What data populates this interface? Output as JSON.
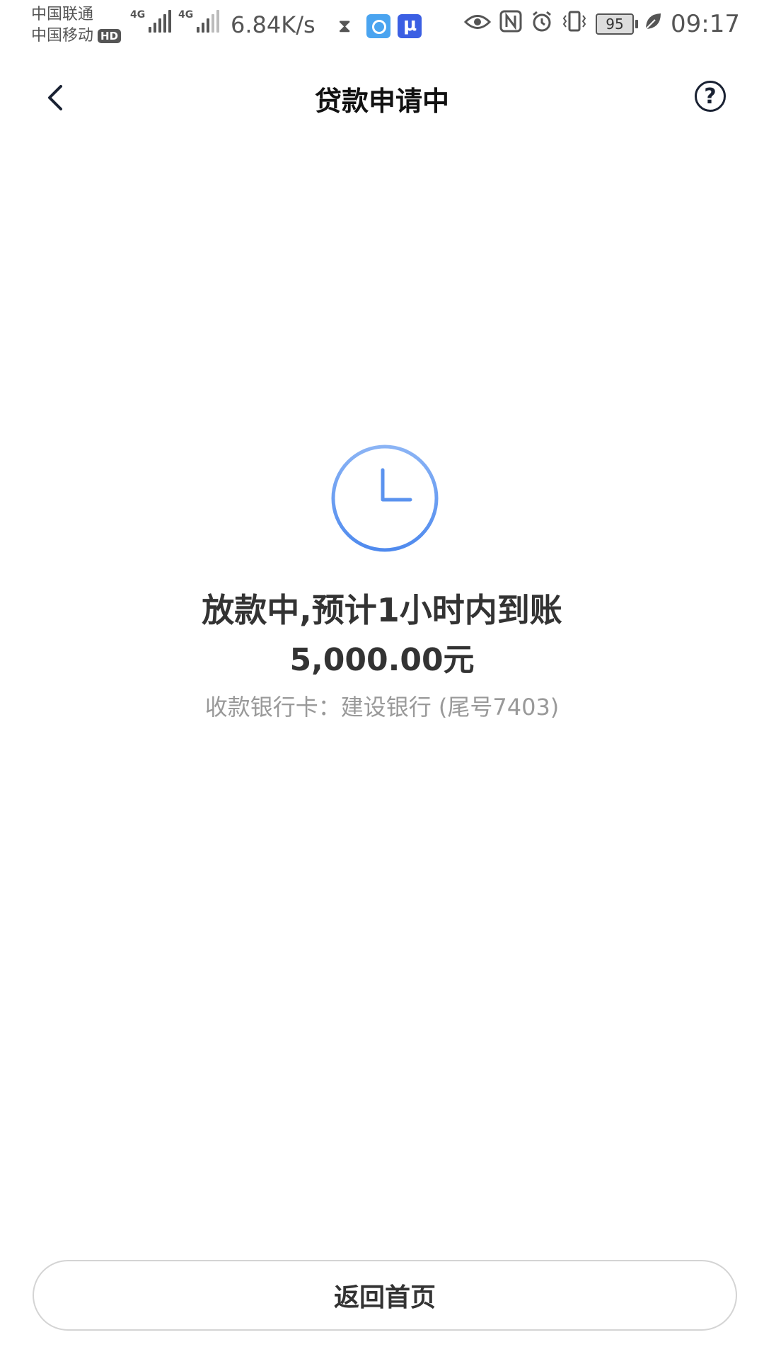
{
  "status_bar": {
    "carrier_1": "中国联通",
    "carrier_2": "中国移动",
    "hd_badge": "HD",
    "network_label": "4G",
    "net_speed": "6.84K/s",
    "battery": "95",
    "time": "09:17",
    "icons": [
      "hourglass-icon",
      "browser-app-icon",
      "utool-app-icon",
      "eye-icon",
      "nfc-icon",
      "alarm-icon",
      "vibrate-icon",
      "battery-icon",
      "leaf-icon"
    ]
  },
  "nav": {
    "title": "贷款申请中",
    "back_icon": "chevron-left-icon",
    "help_icon": "question-circle-icon"
  },
  "status": {
    "icon": "clock-icon",
    "title": "放款中,预计1小时内到账",
    "amount": "5,000.00元",
    "bank_info": "收款银行卡：建设银行 (尾号7403)"
  },
  "footer": {
    "home_button_label": "返回首页"
  },
  "colors": {
    "accent_blue": "#5b93ef",
    "text_dark": "#333333",
    "text_muted": "#999999"
  }
}
